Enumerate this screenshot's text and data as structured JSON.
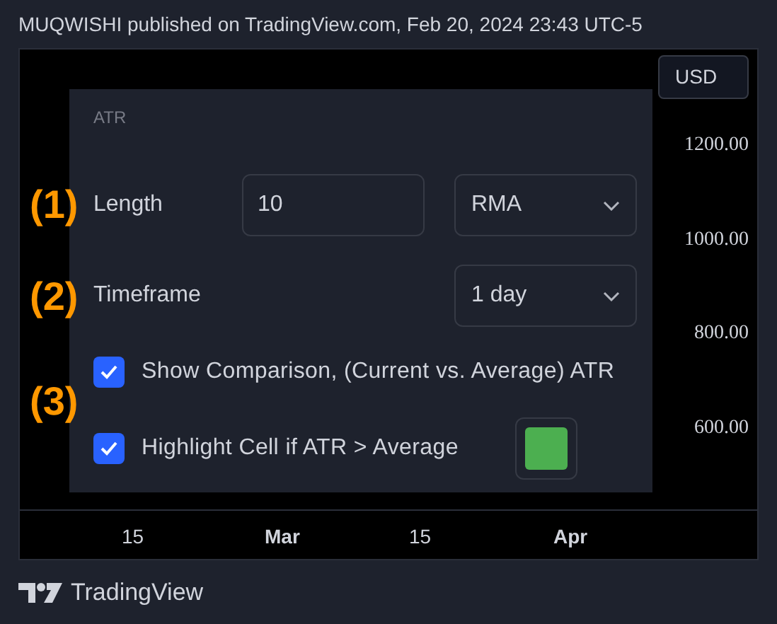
{
  "header": {
    "text": "MUQWISHI published on TradingView.com, Feb 20, 2024 23:43 UTC-5"
  },
  "chart": {
    "currency_button": "USD",
    "price_labels": [
      "1200.00",
      "1000.00",
      "800.00",
      "600.00"
    ],
    "time_labels": [
      {
        "label": "15",
        "major": false
      },
      {
        "label": "Mar",
        "major": true
      },
      {
        "label": "15",
        "major": false
      },
      {
        "label": "Apr",
        "major": true
      }
    ]
  },
  "settings_panel": {
    "title": "ATR",
    "rows": [
      {
        "kind": "inputs",
        "label": "Length",
        "input_value": "10",
        "select_value": "RMA"
      },
      {
        "kind": "select",
        "label": "Timeframe",
        "select_value": "1 day"
      },
      {
        "kind": "checkbox",
        "label": "Show Comparison, (Current vs. Average) ATR",
        "checked": true
      },
      {
        "kind": "checkbox",
        "label": "Highlight Cell if ATR > Average",
        "checked": true,
        "color": "#4caf50"
      }
    ]
  },
  "annotations": [
    "(1)",
    "(2)",
    "(3)"
  ],
  "footer": {
    "logo_text": "TradingView"
  }
}
